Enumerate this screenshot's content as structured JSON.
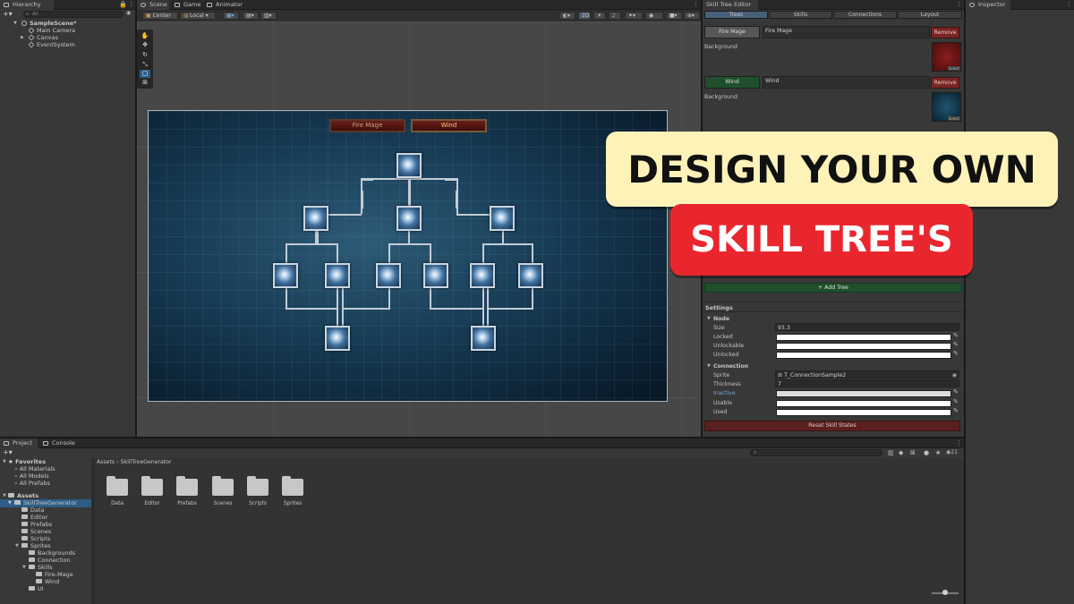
{
  "hierarchy": {
    "tab_label": "Hierarchy",
    "search_placeholder": "All",
    "scene": "SampleScene*",
    "items": [
      "Main Camera",
      "Canvas",
      "EventSystem"
    ]
  },
  "scene_view": {
    "tabs": [
      "Scene",
      "Game",
      "Animator"
    ],
    "toolbar": {
      "pivot": "Center",
      "space": "Local",
      "mode_2d": "2D"
    }
  },
  "game_canvas": {
    "tree_buttons": [
      "Fire Mage",
      "Wind"
    ]
  },
  "skill_tree_editor": {
    "title": "Skill Tree Editor",
    "tabs": [
      "Trees",
      "Skills",
      "Connections",
      "Layout"
    ],
    "trees": [
      {
        "button": "Fire Mage",
        "name": "Fire Mage",
        "remove": "Remove",
        "bg_label": "Background",
        "bg_color": "#6a1414",
        "select": "Select"
      },
      {
        "button": "Wind",
        "name": "Wind",
        "remove": "Remove",
        "bg_label": "Background",
        "bg_color": "#0f3548",
        "select": "Select"
      }
    ],
    "add_tree": "+ Add Tree",
    "settings": {
      "title": "Settings",
      "node_section": "Node",
      "size_label": "Size",
      "size_value": "93.3",
      "locked_label": "Locked",
      "unlockable_label": "Unlockable",
      "unlocked_label": "Unlocked",
      "connection_section": "Connection",
      "sprite_label": "Sprite",
      "sprite_value": "T_ConnectionSample2",
      "thickness_label": "Thickness",
      "thickness_value": "7",
      "inactive_label": "Inactive",
      "usable_label": "Usable",
      "used_label": "Used"
    },
    "reset_button": "Reset Skill States"
  },
  "inspector": {
    "tab_label": "Inspector"
  },
  "promo": {
    "line1": "DESIGN YOUR OWN",
    "line2": "SKILL TREE'S"
  },
  "project": {
    "tabs": [
      "Project",
      "Console"
    ],
    "favorites_label": "Favorites",
    "favorites": [
      "All Materials",
      "All Models",
      "All Prefabs"
    ],
    "assets_label": "Assets",
    "tree": {
      "root": "SkillTreeGenerator",
      "children": [
        "Data",
        "Editor",
        "Prefabs",
        "Scenes",
        "Scripts"
      ],
      "sprites": "Sprites",
      "sprite_children": [
        "Backgrounds",
        "Connection"
      ],
      "skills": "Skills",
      "skill_children": [
        "Fire-Mage",
        "Wind"
      ],
      "ui": "UI"
    },
    "breadcrumb": [
      "Assets",
      "SkillTreeGenerator"
    ],
    "folders": [
      "Data",
      "Editor",
      "Prefabs",
      "Scenes",
      "Scripts",
      "Sprites"
    ],
    "hidden_count": "21"
  },
  "colors": {
    "promo_yellow": "#fdf2b8",
    "promo_red": "#e9262e",
    "add_tree_green": "#1f4f2c",
    "remove_red": "#7a2424",
    "reset_red": "#5c1f1f"
  }
}
